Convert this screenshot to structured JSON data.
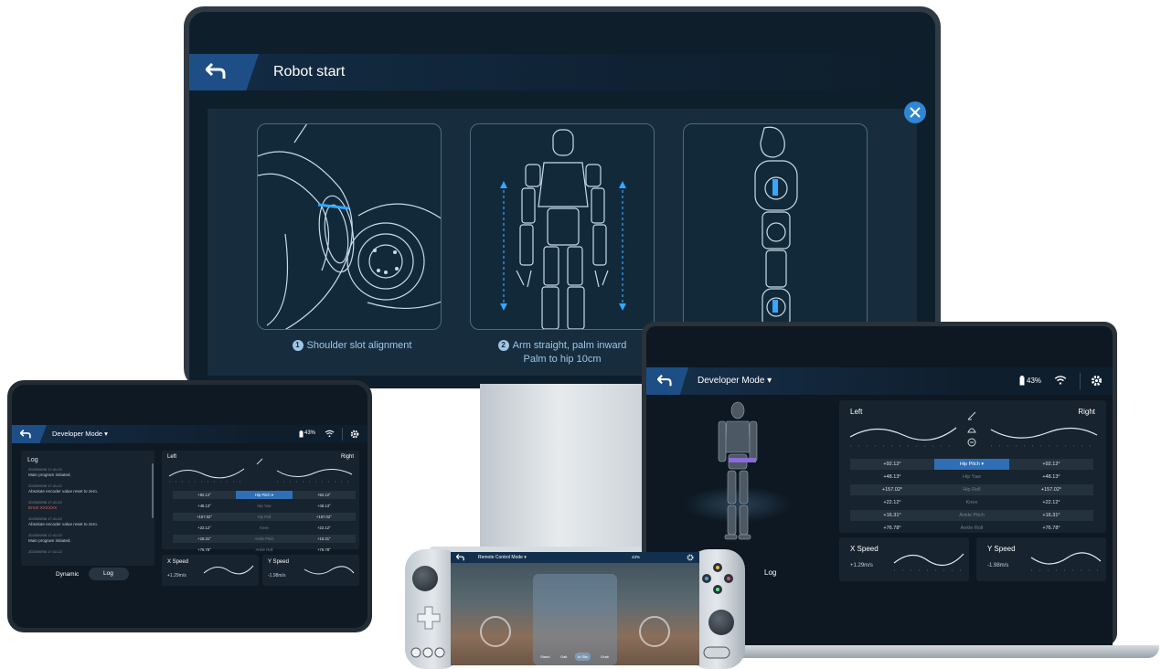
{
  "monitor": {
    "title": "Robot start",
    "steps": [
      {
        "num": "1",
        "caption": "Shoulder slot alignment"
      },
      {
        "num": "2",
        "caption_line1": "Arm straight, palm inward",
        "caption_line2": "Palm to hip 10cm"
      }
    ],
    "accent": "#2f86d6"
  },
  "tablet": {
    "mode": "Developer Mode ▾",
    "battery": "43%",
    "log": {
      "title": "Log",
      "entries": [
        {
          "time": "2023/09/06  17:41:22",
          "text": "Main program initiated.",
          "error": false
        },
        {
          "time": "2023/09/06  17:41:22",
          "text": "Absolute encoder value reset to zero.",
          "error": false
        },
        {
          "time": "2023/09/06  17:41:22",
          "text": "Error! XXXXXX",
          "error": true
        },
        {
          "time": "2023/09/06  17:41:22",
          "text": "Absolute encoder value reset to zero.",
          "error": false
        },
        {
          "time": "2023/09/06  17:41:22",
          "text": "Main program initiated.",
          "error": false
        },
        {
          "time": "2023/09/06  17:41:22",
          "text": "",
          "error": false
        }
      ]
    },
    "chart": {
      "left": "Left",
      "right": "Right"
    },
    "joints": [
      {
        "left": "+92.12°",
        "name": "Hip Pitch ▾",
        "right": "+92.12°",
        "selected": true
      },
      {
        "left": "+48.13°",
        "name": "Hip Yaw",
        "right": "+48.13°",
        "selected": false
      },
      {
        "left": "+157.02°",
        "name": "Hip Roll",
        "right": "+157.02°",
        "selected": false
      },
      {
        "left": "+22.12°",
        "name": "Knee",
        "right": "+22.12°",
        "selected": false
      },
      {
        "left": "+16.31°",
        "name": "Ankle Pitch",
        "right": "+16.31°",
        "selected": false
      },
      {
        "left": "+76.78°",
        "name": "Ankle Roll",
        "right": "+76.78°",
        "selected": false
      }
    ],
    "x_speed": {
      "label": "X Speed",
      "value": "+1.29m/s"
    },
    "y_speed": {
      "label": "Y Speed",
      "value": "-1.98m/s"
    },
    "tabs": [
      "Dynamic",
      "Log"
    ]
  },
  "laptop": {
    "mode": "Developer Mode ▾",
    "battery": "43%",
    "chart": {
      "left": "Left",
      "right": "Right"
    },
    "joints": [
      {
        "left": "+92.12°",
        "name": "Hip Pitch ▾",
        "right": "+92.12°",
        "selected": true
      },
      {
        "left": "+48.13°",
        "name": "Hip Yaw",
        "right": "+48.13°",
        "selected": false
      },
      {
        "left": "+157.02°",
        "name": "Hip Roll",
        "right": "+157.02°",
        "selected": false
      },
      {
        "left": "+22.12°",
        "name": "Knee",
        "right": "+22.12°",
        "selected": false
      },
      {
        "left": "+16.31°",
        "name": "Ankle Pitch",
        "right": "+16.31°",
        "selected": false
      },
      {
        "left": "+76.78°",
        "name": "Ankle Roll",
        "right": "+76.78°",
        "selected": false
      }
    ],
    "x_speed": {
      "label": "X Speed",
      "value": "+1.29m/s"
    },
    "y_speed": {
      "label": "Y Speed",
      "value": "-1.98m/s"
    },
    "log_label": "Log"
  },
  "gamepad": {
    "title": "Remote Control Mode ▾",
    "battery": "43%",
    "bottom_modes": [
      "Stand",
      "Gait",
      "In Situ",
      "Grab"
    ]
  }
}
